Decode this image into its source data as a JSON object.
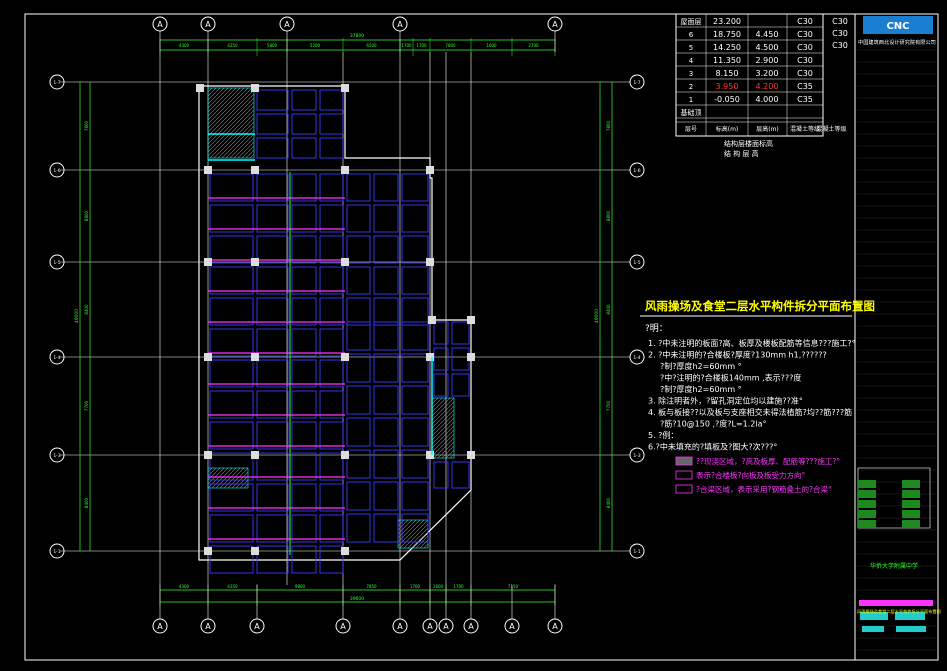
{
  "drawing": {
    "title": "风雨操场及食堂二层水平构件拆分平面布置图",
    "notes_header": "?明：",
    "notes": [
      "1. ?中未注明的板面?高、板厚及楼板配筋等信息???施工?°",
      "2. ?中未注明的?合楼板?厚度?130mm    h1,??????",
      "?制?厚度h2=60mm         °",
      "?中?注明的?合楼板140mm      ,表示???度",
      "?制?厚度h2=60mm         °",
      "3. 除注明者外，?留孔洞定位均以建施??准°",
      "4. 板与板接??以及板与支座相交未得法植筋?均??筋???筋",
      "?筋?10@150      ,?度?L=1.2la°",
      "5. ?例：",
      "6.?中未填充的?填板及?图大?次???°"
    ],
    "legend": [
      {
        "label": "??现浇区域，?高及板厚、配筋等???施工?°",
        "swatch": "hatch"
      },
      {
        "label": "表示?合楼板?向板及板受力方向°",
        "swatch": "arrow"
      },
      {
        "label": "?合梁区域，表示采用?钢筋叠土的?合梁°",
        "swatch": "beam"
      }
    ]
  },
  "floor_table": {
    "rows": [
      {
        "level": "屋面层",
        "elev": "23.200",
        "height": "",
        "grade": "C30"
      },
      {
        "level": "6",
        "elev": "18.750",
        "height": "4.450",
        "grade": "C30"
      },
      {
        "level": "5",
        "elev": "14.250",
        "height": "4.500",
        "grade": "C30"
      },
      {
        "level": "4",
        "elev": "11.350",
        "height": "2.900",
        "grade": "C30"
      },
      {
        "level": "3",
        "elev": "8.150",
        "height": "3.200",
        "grade": "C30"
      },
      {
        "level": "2",
        "elev": "3.950",
        "height": "4.200",
        "grade": "C35"
      },
      {
        "level": "1",
        "elev": "-0.050",
        "height": "4.000",
        "grade": "C35"
      },
      {
        "level": "基础顶",
        "elev": "",
        "height": "",
        "grade": ""
      }
    ],
    "extra_grades": [
      "C30",
      "C30",
      "C30"
    ],
    "headers": [
      "层号",
      "标高(m)",
      "层高(m)",
      "混凝土等级",
      "混凝土等级"
    ],
    "caption_1": "结构层楼面标高",
    "caption_2": "结 构 层 高"
  },
  "grid": {
    "top_axes": [
      "A",
      "A",
      "A",
      "A",
      "A"
    ],
    "bottom_axes": [
      "A",
      "A",
      "A",
      "A",
      "A",
      "A",
      "A",
      "A",
      "A",
      "A"
    ],
    "row_axes": [
      "1-7",
      "1-6",
      "1-5",
      "1-4",
      "1-3",
      "1-2",
      "1-1"
    ],
    "top_dims": [
      "4300",
      "4250",
      "5800",
      "5200",
      "6500",
      "1700",
      "1700",
      "7800",
      "1600",
      "2700"
    ],
    "top_total": "37800",
    "bottom_dims": [
      "4300",
      "4350",
      "9800",
      "7850",
      "1700",
      "1600",
      "1700",
      "7150"
    ],
    "bottom_total": "39600",
    "side_dims": [
      "7800",
      "8800",
      "8400",
      "7700",
      "8400",
      "8600"
    ],
    "side_total": "49000"
  },
  "title_block": {
    "company": "中国建筑西北设计研究院有限公司",
    "project": "华侨大学附属中学",
    "sheet": "风雨操场及食堂二层水平构件拆分平面布置图",
    "logo": "CNC"
  },
  "colors": {
    "background": "#000000",
    "grid": "#ffffff",
    "slab": "#3b3bff",
    "wall": "#00ffff",
    "beam": "#ff33ff",
    "dim": "#33ff33",
    "highlight": "#ff33ff"
  }
}
